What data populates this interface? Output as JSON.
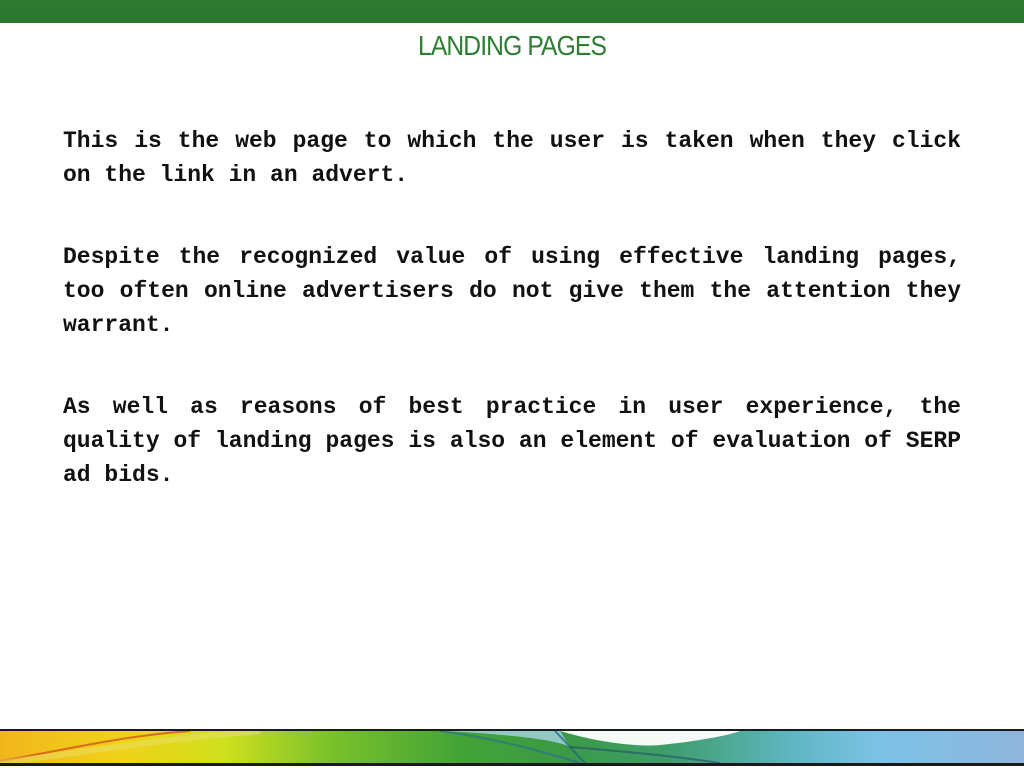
{
  "slide": {
    "title": "LANDING PAGES",
    "paragraphs": [
      "This is the web page to which the user is taken when they click on the link in an advert.",
      "Despite the recognized value of using effective landing pages, too often online advertisers do not give them the attention they warrant.",
      "As well as reasons of best practice in user experience, the quality of landing pages is also an element of evaluation of SERP ad bids."
    ]
  },
  "colors": {
    "accent_green": "#2e7d32",
    "top_bar": "#2f7a32",
    "text": "#111111"
  }
}
